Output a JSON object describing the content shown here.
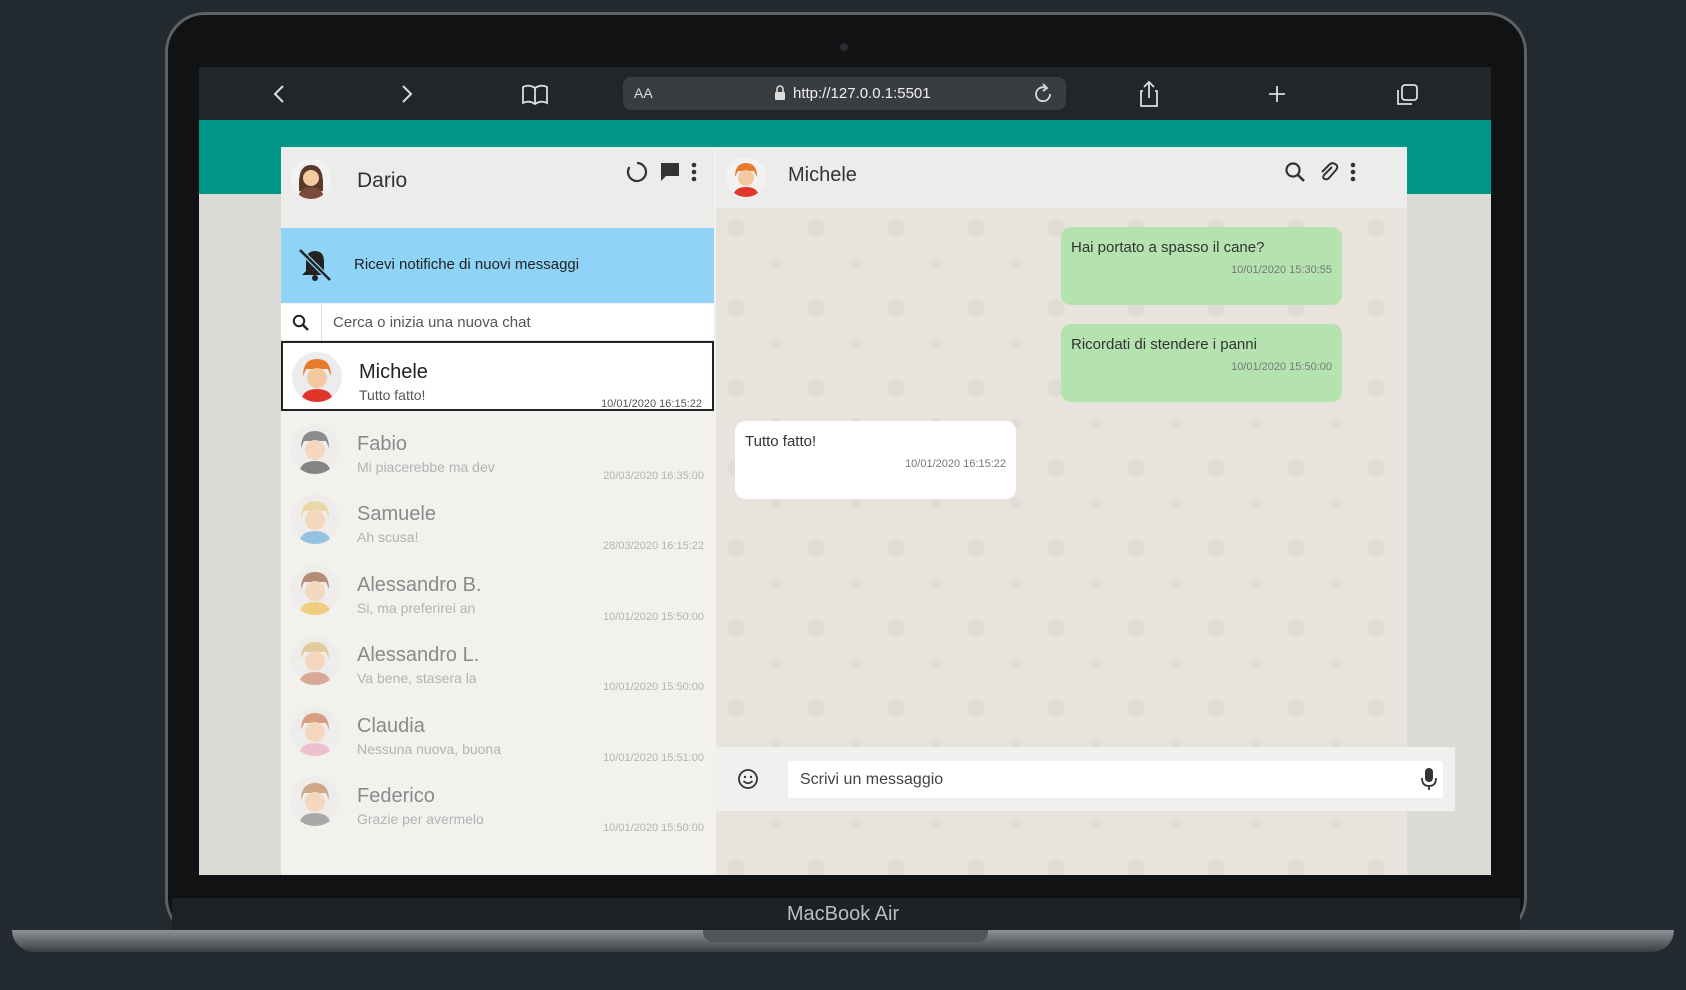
{
  "device": {
    "label": "MacBook Air"
  },
  "browser": {
    "text_size_label": "AA",
    "url": "http://127.0.0.1:5501",
    "icons": [
      "back-icon",
      "forward-icon",
      "bookmarks-icon",
      "lock-icon",
      "reload-icon",
      "share-icon",
      "new-tab-icon",
      "tabs-icon"
    ]
  },
  "sidebar": {
    "user_name": "Dario",
    "notification_text": "Ricevi notifiche di nuovi messaggi",
    "search_placeholder": "Cerca o inizia una nuova chat",
    "contacts": [
      {
        "name": "Michele",
        "preview": "Tutto fatto!",
        "time": "10/01/2020 16:15:22",
        "active": true,
        "hair": "#e87a2c",
        "shirt": "#e0352b"
      },
      {
        "name": "Fabio",
        "preview": "Mi piacerebbe ma dev",
        "time": "20/03/2020 16:35:00",
        "active": false,
        "hair": "#4a4a4a",
        "shirt": "#3d3d3d"
      },
      {
        "name": "Samuele",
        "preview": "Ah scusa!",
        "time": "28/03/2020 16:15:22",
        "active": false,
        "hair": "#e8c77a",
        "shirt": "#58a6d6"
      },
      {
        "name": "Alessandro B.",
        "preview": "Si, ma preferirei an",
        "time": "10/01/2020 15:50:00",
        "active": false,
        "hair": "#8b4a2b",
        "shirt": "#f1b63a"
      },
      {
        "name": "Alessandro L.",
        "preview": "Va bene, stasera la",
        "time": "10/01/2020 15:50:00",
        "active": false,
        "hair": "#d9b46a",
        "shirt": "#c77a5a"
      },
      {
        "name": "Claudia",
        "preview": "Nessuna nuova, buona",
        "time": "10/01/2020 15:51:00",
        "active": false,
        "hair": "#c9683b",
        "shirt": "#e9a0b8"
      },
      {
        "name": "Federico",
        "preview": "Grazie per avermelo",
        "time": "10/01/2020 15:50:00",
        "active": false,
        "hair": "#b77a45",
        "shirt": "#7a7a7a"
      }
    ]
  },
  "chat": {
    "contact_name": "Michele",
    "messages": [
      {
        "direction": "sent",
        "text": "Hai portato a spasso il cane?",
        "time": "10/01/2020 15:30:55"
      },
      {
        "direction": "sent",
        "text": "Ricordati di stendere i panni",
        "time": "10/01/2020 15:50:00"
      },
      {
        "direction": "received",
        "text": "Tutto fatto!",
        "time": "10/01/2020 16:15:22"
      }
    ],
    "input_placeholder": "Scrivi un messaggio"
  },
  "colors": {
    "teal": "#009688",
    "sent_bubble": "#b5e3b0",
    "notification_bg": "#8fd3f7"
  }
}
